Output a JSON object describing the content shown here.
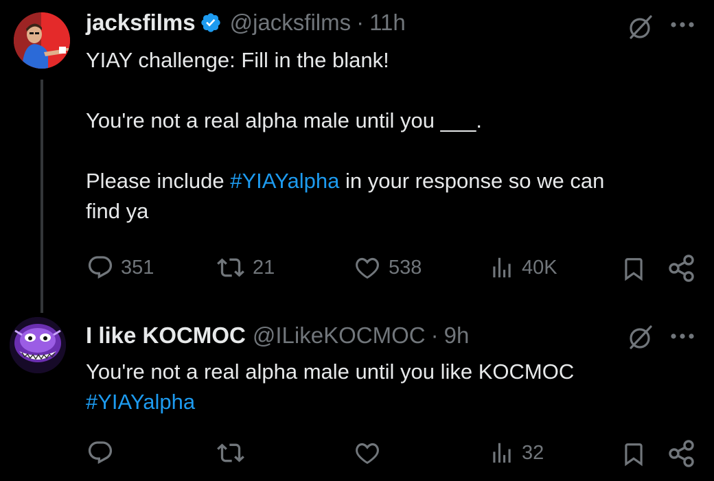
{
  "tweet1": {
    "display_name": "jacksfilms",
    "handle": "@jacksfilms",
    "separator": "·",
    "time": "11h",
    "text_line1": "YIAY challenge: Fill in the blank!",
    "text_line2": "You're not a real alpha male until you ___.",
    "text_line3_before": "Please include ",
    "hashtag": "#YIAYalpha",
    "text_line3_after": " in your response so we can",
    "text_line4": "find ya",
    "replies": "351",
    "retweets": "21",
    "likes": "538",
    "views": "40K"
  },
  "tweet2": {
    "display_name": "I like KOCMOC",
    "handle": "@ILikeKOCMOC",
    "separator": "·",
    "time": "9h",
    "text_line1": "You're not a real alpha male until you like KOCMOC",
    "hashtag": "#YIAYalpha",
    "views": "32"
  },
  "colors": {
    "background": "#000000",
    "text": "#e7e9ea",
    "muted": "#71767b",
    "link": "#1d9bf0",
    "verified": "#1d9bf0"
  },
  "icons": [
    "grok-icon",
    "more-icon",
    "reply-icon",
    "retweet-icon",
    "like-icon",
    "views-icon",
    "bookmark-icon",
    "share-icon",
    "verified-icon"
  ]
}
